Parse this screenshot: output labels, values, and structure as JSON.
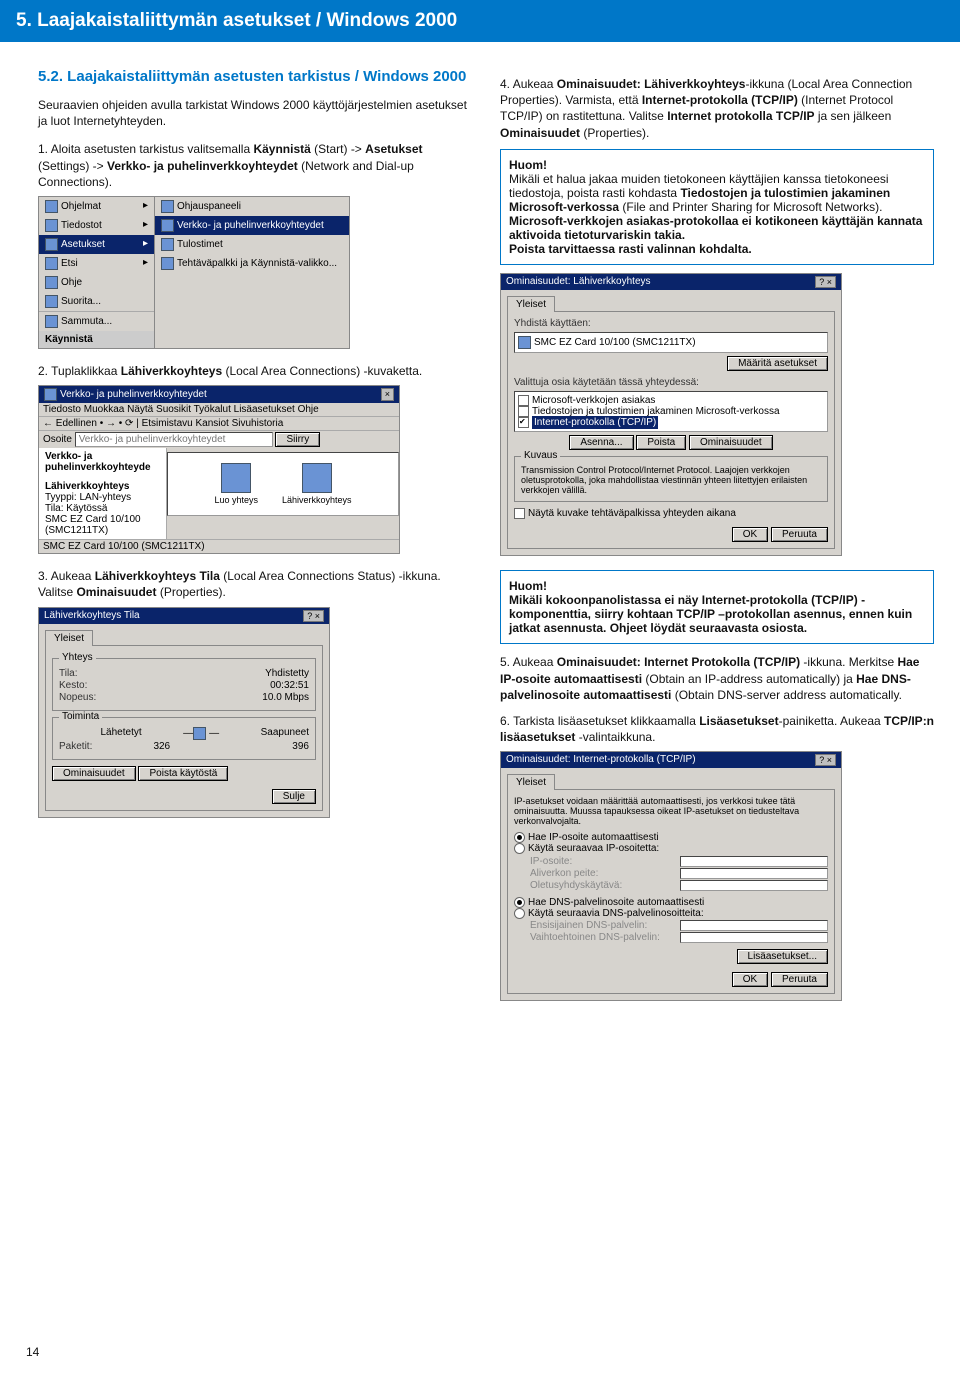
{
  "header": "5. Laajakaistaliittymän asetukset / Windows 2000",
  "subtitle": "5.2. Laajakaistaliittymän asetusten tarkistus / Windows 2000",
  "intro": "Seuraavien ohjeiden avulla tarkistat Windows 2000 käyttöjärjestelmien asetukset ja luot Internetyhteyden.",
  "step1": {
    "num": "1.",
    "text_a": "Aloita asetusten tarkistus valitsemalla ",
    "b1": "Käynnistä",
    "text_b": " (Start) -> ",
    "b2": "Asetukset",
    "text_c": " (Settings) -> ",
    "b3": "Verkko- ja puhelinverkkoyhteydet",
    "text_d": " (Network and Dial-up Connections)."
  },
  "start": {
    "left": [
      "Ohjelmat",
      "Tiedostot",
      "Asetukset",
      "Etsi",
      "Ohje",
      "Suorita...",
      "Sammuta..."
    ],
    "start": "Käynnistä",
    "right": [
      "Ohjauspaneeli",
      "Verkko- ja puhelinverkkoyhteydet",
      "Tulostimet",
      "Tehtäväpalkki ja Käynnistä-valikko..."
    ]
  },
  "step2": {
    "num": "2.",
    "text_a": "Tuplaklikkaa ",
    "b1": "Lähiverkkoyhteys",
    "text_b": " (Local Area Connections) -kuvaketta."
  },
  "explorer": {
    "title": "Verkko- ja puhelinverkkoyhteydet",
    "menu": "Tiedosto  Muokkaa  Näytä  Suosikit  Työkalut  Lisäasetukset  Ohje",
    "tbar": "← Edellinen • → • ⟳ | Etsimistavu  Kansiot  Sivuhistoria",
    "addr_lbl": "Osoite",
    "addr": "Verkko- ja puhelinverkkoyhteydet",
    "go": "Siirry",
    "pane": "Verkko- ja puhelinverkkoyhteyde",
    "icons": [
      "Luo yhteys",
      "Lähiverkkoyhteys"
    ],
    "det_h": "Lähiverkkoyhteys",
    "det1": "Tyyppi: LAN-yhteys",
    "det2": "Tila: Käytössä",
    "det3": "SMC EZ Card 10/100 (SMC1211TX)",
    "status": "SMC EZ Card 10/100 (SMC1211TX)"
  },
  "step3": {
    "num": "3.",
    "text_a": "Aukeaa ",
    "b1": "Lähiverkkoyhteys Tila",
    "text_b": " (Local Area Connections Status) -ikkuna. Valitse ",
    "b2": "Ominaisuudet",
    "text_c": " (Properties)."
  },
  "statuswin": {
    "title": "Lähiverkkoyhteys Tila",
    "tab": "Yleiset",
    "g1": "Yhteys",
    "r1a": "Tila:",
    "r1b": "Yhdistetty",
    "r2a": "Kesto:",
    "r2b": "00:32:51",
    "r3a": "Nopeus:",
    "r3b": "10.0 Mbps",
    "g2": "Toiminta",
    "sent": "Lähetetyt",
    "recv": "Saapuneet",
    "p": "Paketit:",
    "pv1": "326",
    "pv2": "396",
    "b1": "Ominaisuudet",
    "b2": "Poista käytöstä",
    "close": "Sulje"
  },
  "step4": {
    "num": "4.",
    "text_a": "Aukeaa ",
    "b1": "Ominaisuudet: Lähiverkkoyhteys",
    "text_b": "-ikkuna (Local Area Connection Properties). Varmista, että ",
    "b2": "Internet-protokolla (TCP/IP)",
    "text_c": " (Internet Protocol TCP/IP) on rastitettuna. Valitse ",
    "b3": "Internet protokolla TCP/IP",
    "text_d": " ja sen jälkeen ",
    "b4": "Ominaisuudet",
    "text_e": " (Properties)."
  },
  "note1": {
    "h": "Huom!",
    "body_a": "Mikäli et halua jakaa muiden tietokoneen käyttäjien kanssa tietokoneesi tiedostoja, poista rasti kohdasta ",
    "b1": "Tiedostojen ja tulostimien jakaminen Microsoft-verkossa",
    "body_b": " (File and Printer Sharing for Microsoft Networks).",
    "body_c": "Microsoft-verkkojen asiakas-protokollaa ei kotikoneen käyttäjän kannata aktivoida tietoturvariskin takia.",
    "body_d": "Poista tarvittaessa rasti valinnan kohdalta."
  },
  "propwin": {
    "title": "Ominaisuudet: Lähiverkkoyhteys",
    "tab": "Yleiset",
    "connect": "Yhdistä käyttäen:",
    "card": "SMC EZ Card 10/100 (SMC1211TX)",
    "cfg": "Määritä asetukset",
    "components": "Valittuja osia käytetään tässä yhteydessä:",
    "c1": "Microsoft-verkkojen asiakas",
    "c2": "Tiedostojen ja tulostimien jakaminen Microsoft-verkossa",
    "c3": "Internet-protokolla (TCP/IP)",
    "b1": "Asenna...",
    "b2": "Poista",
    "b3": "Ominaisuudet",
    "desc_h": "Kuvaus",
    "desc": "Transmission Control Protocol/Internet Protocol. Laajojen verkkojen oletusprotokolla, joka mahdollistaa viestinnän yhteen liitettyjen erilaisten verkkojen välillä.",
    "tray": "Näytä kuvake tehtäväpalkissa yhteyden aikana",
    "ok": "OK",
    "cancel": "Peruuta"
  },
  "note2": {
    "h": "Huom!",
    "body": "Mikäli kokoonpanolistassa ei näy Internet-protokolla (TCP/IP) -komponenttia, siirry kohtaan TCP/IP –protokollan asennus, ennen kuin jatkat asennusta. Ohjeet löydät seuraavasta osiosta."
  },
  "step5": {
    "num": "5.",
    "text_a": "Aukeaa ",
    "b1": "Ominaisuudet: Internet Protokolla (TCP/IP)",
    "text_b": " -ikkuna. Merkitse ",
    "b2": "Hae IP-osoite automaattisesti",
    "text_c": " (Obtain an IP-address automatically) ja ",
    "b3": "Hae DNS-palvelinosoite automaattisesti",
    "text_d": " (Obtain DNS-server address automatically."
  },
  "step6": {
    "num": "6.",
    "text_a": "Tarkista lisäasetukset klikkaamalla ",
    "b1": "Lisäasetukset",
    "text_b": "-painiketta. Aukeaa ",
    "b2": "TCP/IP:n lisäasetukset",
    "text_c": " -valintaikkuna."
  },
  "tcpwin": {
    "title": "Ominaisuudet: Internet-protokolla (TCP/IP)",
    "tab": "Yleiset",
    "intro": "IP-asetukset voidaan määrittää automaattisesti, jos verkkosi tukee tätä ominaisuutta. Muussa tapauksessa oikeat IP-asetukset on tiedusteltava verkonvalvojalta.",
    "r1": "Hae IP-osoite automaattisesti",
    "r2": "Käytä seuraavaa IP-osoitetta:",
    "f1": "IP-osoite:",
    "f2": "Aliverkon peite:",
    "f3": "Oletusyhdyskäytävä:",
    "r3": "Hae DNS-palvelinosoite automaattisesti",
    "r4": "Käytä seuraavia DNS-palvelinosoitteita:",
    "f4": "Ensisijainen DNS-palvelin:",
    "f5": "Vaihtoehtoinen DNS-palvelin:",
    "adv": "Lisäasetukset...",
    "ok": "OK",
    "cancel": "Peruuta"
  },
  "pageno": "14"
}
